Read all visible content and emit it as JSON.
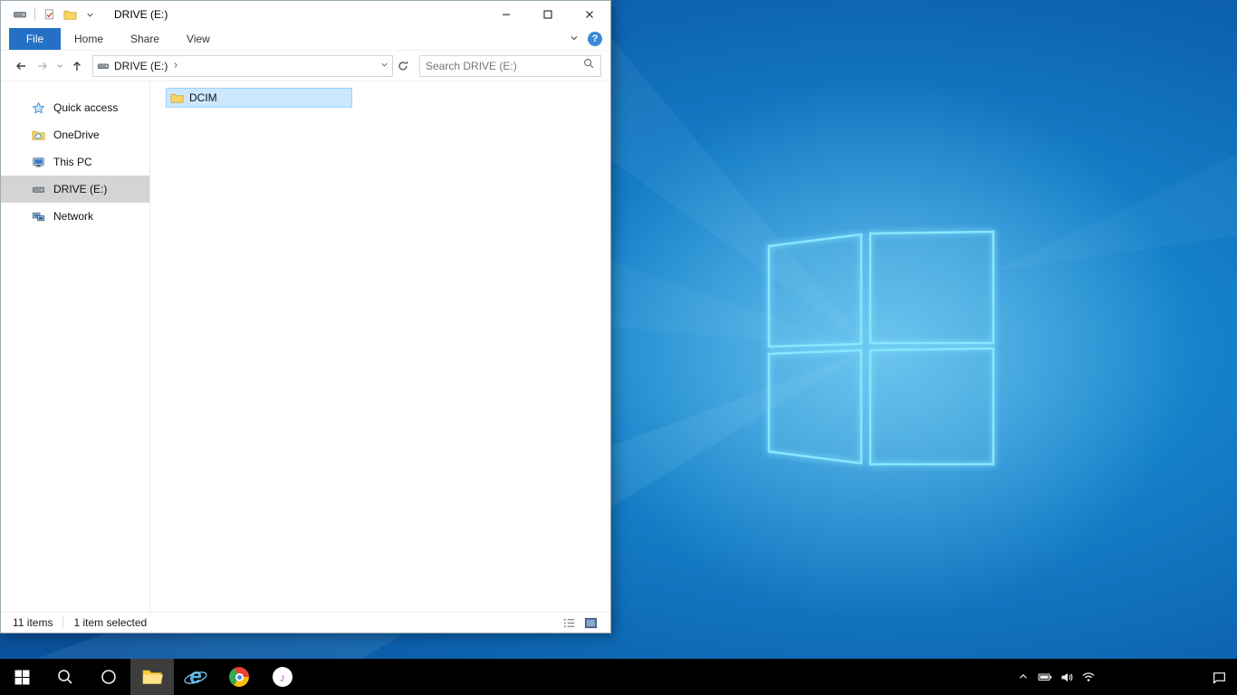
{
  "window": {
    "title": "DRIVE (E:)"
  },
  "ribbon": {
    "file_tab": "File",
    "tabs": [
      "Home",
      "Share",
      "View"
    ],
    "help_glyph": "?"
  },
  "navbar": {
    "breadcrumb": "DRIVE (E:)",
    "search_placeholder": "Search DRIVE (E:)",
    "search_value": ""
  },
  "sidebar": {
    "items": [
      {
        "label": "Quick access",
        "icon": "quick-access-star-icon",
        "selected": false
      },
      {
        "label": "OneDrive",
        "icon": "onedrive-icon",
        "selected": false
      },
      {
        "label": "This PC",
        "icon": "this-pc-icon",
        "selected": false
      },
      {
        "label": "DRIVE (E:)",
        "icon": "drive-icon",
        "selected": true
      },
      {
        "label": "Network",
        "icon": "network-icon",
        "selected": false
      }
    ]
  },
  "files": {
    "items": [
      {
        "name": "DCIM",
        "icon": "folder-icon",
        "selected": true
      }
    ]
  },
  "statusbar": {
    "total": "11 items",
    "selected": "1 item selected"
  },
  "icons": {
    "ie_letter": "e",
    "itunes_note": "♪"
  },
  "taskbar": {
    "buttons": [
      "start",
      "search",
      "cortana",
      "file-explorer",
      "internet-explorer",
      "chrome",
      "itunes"
    ],
    "active_button": "file-explorer",
    "tray": [
      "chevron-up",
      "battery",
      "volume",
      "wifi",
      "action-center"
    ]
  },
  "colors": {
    "file_tab_blue": "#2470c4",
    "help_blue": "#3c8bd9",
    "selection_fill": "#cce8ff",
    "selection_border": "#99d1ff",
    "sidebar_selected": "#d4d4d4",
    "folder_yellow": "#fbd566",
    "taskbar_black": "#000000",
    "taskbar_active": "#3d3d3d",
    "wallpaper_center": "#2fa3e0",
    "wallpaper_edge": "#0a519c",
    "logo_glow": "#8ae6ff"
  }
}
